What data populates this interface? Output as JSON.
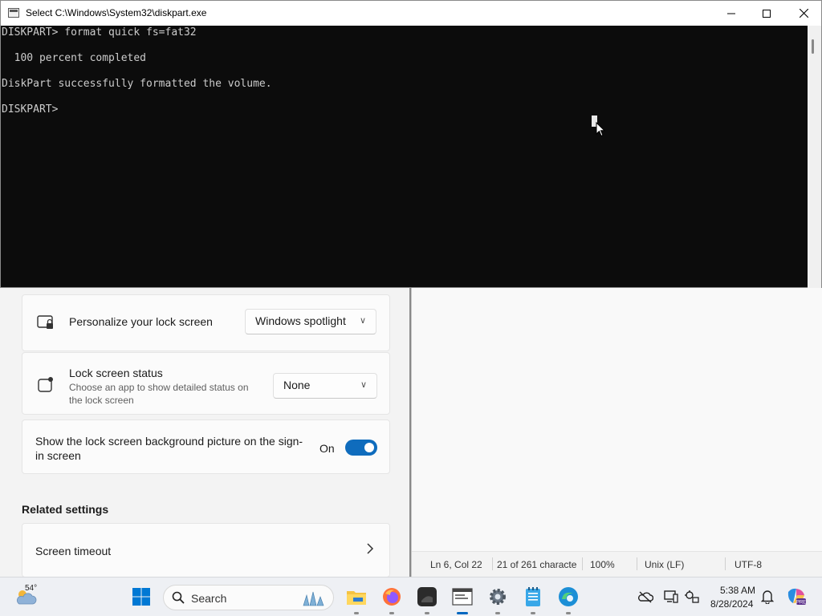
{
  "console": {
    "title": "Select C:\\Windows\\System32\\diskpart.exe",
    "lines": [
      "DISKPART> format quick fs=fat32",
      "",
      "  100 percent completed",
      "",
      "DiskPart successfully formatted the volume.",
      "",
      "DISKPART> "
    ],
    "background": "#0c0c0c",
    "foreground": "#cccccc"
  },
  "settings": {
    "personalize": {
      "title": "Personalize your lock screen",
      "value": "Windows spotlight"
    },
    "status": {
      "title": "Lock screen status",
      "desc_line1": "Choose an app to show detailed status on",
      "desc_line2": "the lock screen",
      "value": "None"
    },
    "signin": {
      "line1": "Show the lock screen background picture on the sign-",
      "line2": "in screen",
      "state": "On"
    },
    "related_heading": "Related settings",
    "screen_timeout": "Screen timeout",
    "accent": "#0f6cbd"
  },
  "notepad": {
    "status": {
      "position": "Ln 6, Col 22",
      "chars": "21 of 261 characte",
      "zoom": "100%",
      "line_ending": "Unix (LF)",
      "encoding": "UTF-8"
    }
  },
  "taskbar": {
    "weather": "54°",
    "search_label": "Search",
    "time": "5:38 AM",
    "date": "8/28/2024",
    "icons": [
      "start-icon",
      "search-icon",
      "file-explorer-icon",
      "firefox-icon",
      "media-player-icon",
      "diskpart-console-icon",
      "settings-icon",
      "notepad-icon",
      "edge-icon"
    ],
    "tray": [
      "onedrive-offline-icon",
      "devices-icon",
      "location-icon",
      "notifications-icon",
      "copilot-icon"
    ]
  }
}
